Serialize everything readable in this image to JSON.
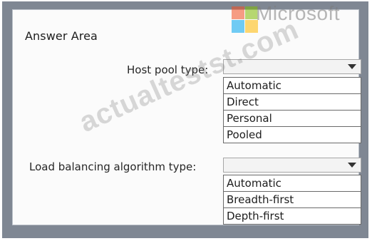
{
  "branding": {
    "logo_text": "Microsoft",
    "logo_colors": [
      "#f25022",
      "#7fba00",
      "#00a4ef",
      "#ffb900"
    ]
  },
  "watermark": "actualtestst.com",
  "answer_area": {
    "title": "Answer Area",
    "host_pool": {
      "label": "Host pool type:",
      "selected_value": "",
      "options": [
        "Automatic",
        "Direct",
        "Personal",
        "Pooled"
      ]
    },
    "load_balancing": {
      "label": "Load balancing algorithm type:",
      "selected_value": "",
      "options": [
        "Automatic",
        "Breadth-first",
        "Depth-first"
      ]
    }
  },
  "icons": {
    "dropdown": "chevron-down-icon"
  }
}
